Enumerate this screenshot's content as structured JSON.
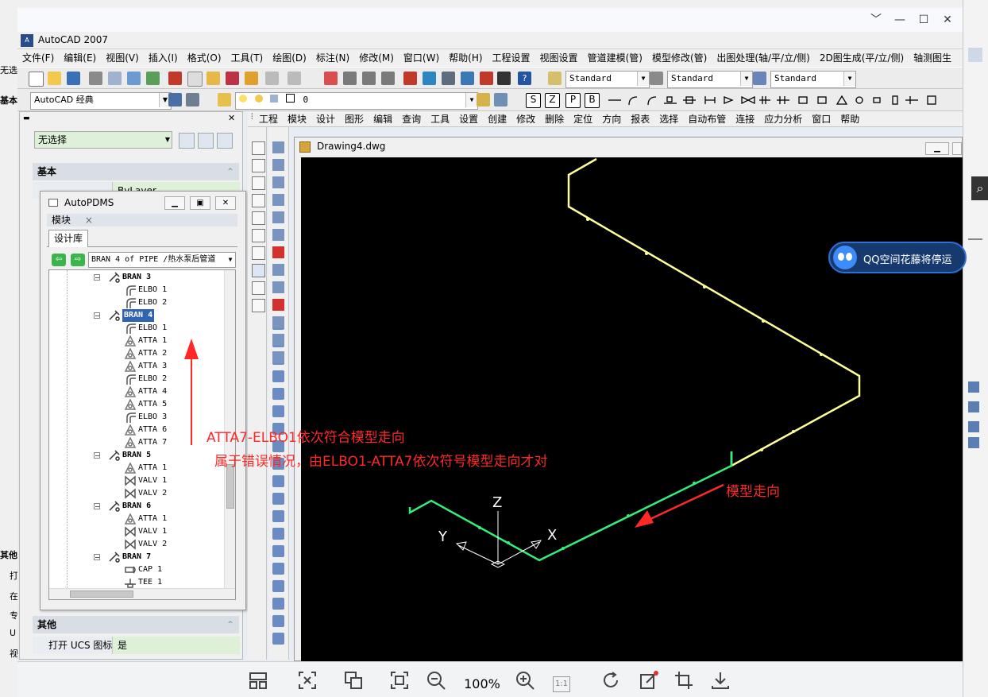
{
  "window": {
    "app_title": "AutoCAD 2007",
    "controls": [
      "﹀",
      "—",
      "☐",
      "✕"
    ]
  },
  "menu": [
    "文件(F)",
    "编辑(E)",
    "视图(V)",
    "插入(I)",
    "格式(O)",
    "工具(T)",
    "绘图(D)",
    "标注(N)",
    "修改(M)",
    "窗口(W)",
    "帮助(H)",
    "工程设置",
    "视图设置",
    "管道建模(管)",
    "模型修改(管)",
    "出图处理(轴/平/立/侧)",
    "2D图生成(平/立/侧)",
    "轴测图生"
  ],
  "toolbar": {
    "text_style": "Standard",
    "dim_style": "Standard",
    "table_style": "Standard",
    "workspace": "AutoCAD 经典",
    "layer_value": "0",
    "sp_labels": [
      "S",
      "Z",
      "P",
      "B"
    ]
  },
  "left_strip": {
    "fragments": [
      "无选",
      "基本",
      "其他",
      "打",
      "在",
      "专",
      "U",
      "视"
    ]
  },
  "properties": {
    "selection": "无选择",
    "section_basic": "基本",
    "section_other": "其他",
    "ucs_label": "打开 UCS 图标",
    "ucs_value": "是",
    "partial_row_value": "ByLayer"
  },
  "pdms": {
    "title": "AutoPDMS",
    "tab_module": "模块",
    "tab_close": "×",
    "tab_design_library": "设计库",
    "branch_selector": "BRAN 4 of PIPE /热水泵后管道",
    "tree": [
      {
        "label": "BRAN 3",
        "type": "bran"
      },
      {
        "label": "ELBO 1",
        "type": "elbo"
      },
      {
        "label": "ELBO 2",
        "type": "elbo"
      },
      {
        "label": "BRAN 4",
        "type": "bran",
        "selected": true
      },
      {
        "label": "ELBO 1",
        "type": "elbo"
      },
      {
        "label": "ATTA 1",
        "type": "atta"
      },
      {
        "label": "ATTA 2",
        "type": "atta"
      },
      {
        "label": "ATTA 3",
        "type": "atta"
      },
      {
        "label": "ELBO 2",
        "type": "elbo"
      },
      {
        "label": "ATTA 4",
        "type": "atta"
      },
      {
        "label": "ATTA 5",
        "type": "atta"
      },
      {
        "label": "ELBO 3",
        "type": "elbo"
      },
      {
        "label": "ATTA 6",
        "type": "atta"
      },
      {
        "label": "ATTA 7",
        "type": "atta"
      },
      {
        "label": "BRAN 5",
        "type": "bran"
      },
      {
        "label": "ATTA 1",
        "type": "atta"
      },
      {
        "label": "VALV 1",
        "type": "valv"
      },
      {
        "label": "VALV 2",
        "type": "valv"
      },
      {
        "label": "BRAN 6",
        "type": "bran"
      },
      {
        "label": "ATTA 1",
        "type": "atta"
      },
      {
        "label": "VALV 1",
        "type": "valv"
      },
      {
        "label": "VALV 2",
        "type": "valv"
      },
      {
        "label": "BRAN 7",
        "type": "bran"
      },
      {
        "label": "CAP 1",
        "type": "cap"
      },
      {
        "label": "TEE 1",
        "type": "tee"
      }
    ]
  },
  "command_menu": [
    "工程",
    "模块",
    "设计",
    "图形",
    "编辑",
    "查询",
    "工具",
    "设置",
    "创建",
    "修改",
    "删除",
    "定位",
    "方向",
    "报表",
    "选择",
    "自动布管",
    "连接",
    "应力分析",
    "窗口",
    "帮助"
  ],
  "drawing": {
    "tab_title": "Drawing4.dwg",
    "axis_x": "X",
    "axis_y": "Y",
    "axis_z": "Z",
    "pipe_upper_color": "#ffff99",
    "pipe_lower_color": "#33ee77"
  },
  "notification": {
    "text": "QQ空间花藤将停运"
  },
  "annotations": {
    "note_line1": "ATTA7-ELBO1依次符合模型走向",
    "note_line2": "属于错误情况，由ELBO1-ATTA7依次符号模型走向才对",
    "direction_label": "模型走向",
    "color": "#ff2828"
  },
  "viewer": {
    "zoom": "100%",
    "ratio_label": "1:1"
  }
}
